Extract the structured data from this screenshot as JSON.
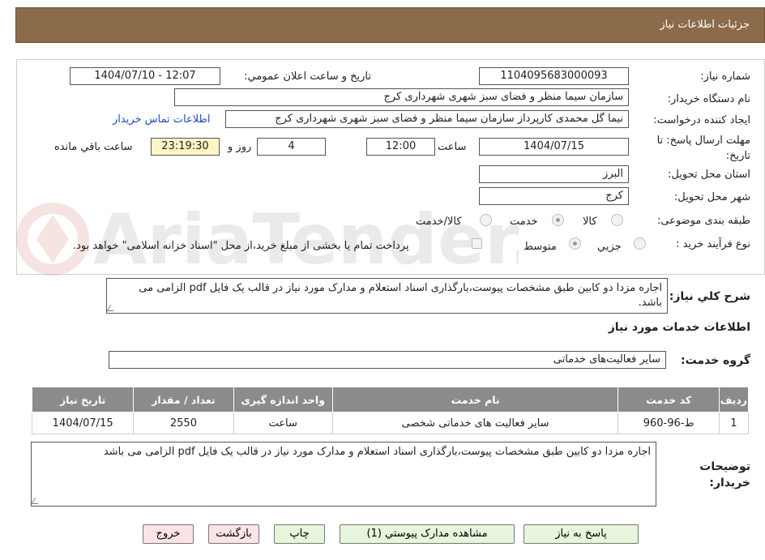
{
  "header": {
    "title": "جزئیات اطلاعات نیاز"
  },
  "form": {
    "need_number_label": "شماره نیاز:",
    "need_number": "1104095683000093",
    "announce_label": "تاریخ و ساعت اعلان عمومي:",
    "announce_value": "1404/07/10 - 12:07",
    "buyer_org_label": "نام دستگاه خريدار:",
    "buyer_org": "سازمان سیما منظر و فضای سبز شهری شهرداری کرج",
    "requester_label": "ايجاد كننده درخواست:",
    "requester": "نیما گل محمدی کارپرداز سازمان سیما منظر و فضای سبز شهری شهرداری کرج",
    "buyer_contact_link": "اطلاعات تماس خريدار",
    "deadline_label": "مهلت ارسال پاسخ: تا تاریخ:",
    "deadline_date": "1404/07/15",
    "time_label": "ساعت",
    "deadline_time": "12:00",
    "days_value": "4",
    "days_label": "روز و",
    "remaining_time": "23:19:30",
    "remaining_label": "ساعت باقي مانده",
    "province_label": "استان محل تحويل:",
    "province": "البرز",
    "city_label": "شهر محل تحويل:",
    "city": "کرج",
    "category_label": "طبقه بندی موضوعی:",
    "category_options": {
      "goods": "كالا",
      "service": "خدمت",
      "goods_service": "كالا/خدمت"
    },
    "purchase_type_label": "نوع فرآيند خريد :",
    "purchase_options": {
      "partial": "جزيي",
      "medium": "متوسط"
    },
    "payment_note": "پرداخت تمام يا بخشی از مبلغ خريد،از محل \"اسناد خزانه اسلامی\" خواهد بود."
  },
  "summary": {
    "label": "شرح كلي نياز:",
    "text": "اجاره مزدا دو کابین طبق مشخصات پیوست،بارگذاری اسناد استعلام و مدارک مورد نیاز در قالب یک فایل pdf الزامی می باشد."
  },
  "services": {
    "section_title": "اطلاعات خدمات مورد نياز",
    "group_label": "گروه خدمت:",
    "group_value": "سایر فعالیت‌های خدماتی",
    "columns": [
      "رديف",
      "كد خدمت",
      "نام خدمت",
      "واحد اندازه گيری",
      "تعداد / مقدار",
      "تاريخ نياز"
    ],
    "rows": [
      [
        "1",
        "ط-96-960",
        "سایر فعالیت های خدماتی شخصی",
        "ساعت",
        "2550",
        "1404/07/15"
      ]
    ]
  },
  "buyer_notes": {
    "label": "توضيحات خريدار:",
    "text": "اجاره مزدا دو کابین طبق مشخصات پیوست،بارگذاری اسناد استعلام و مدارک مورد نیاز در قالب یک فایل pdf الزامی می باشد"
  },
  "buttons": {
    "reply": "پاسخ به نياز",
    "attachments": "مشاهده مدارک پيوستي (1)",
    "print": "چاپ",
    "back": "بازگشت",
    "exit": "خروج"
  },
  "watermark": {
    "text": "AriaTender.neT"
  },
  "colors": {
    "header": "#8b6b4a",
    "table_header": "#8b8b8b",
    "link": "#1d4fbf"
  }
}
